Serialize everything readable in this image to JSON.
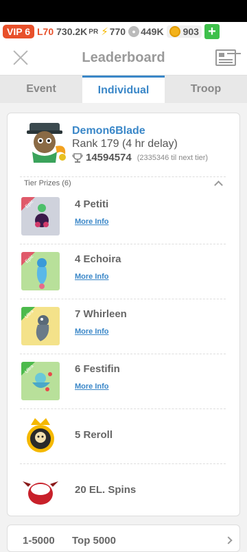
{
  "resources": {
    "vip": "VIP 6",
    "level": "L70",
    "power": "730.2K",
    "power_unit": "PR",
    "energy": "770",
    "food": "449K",
    "gems": "903"
  },
  "header": {
    "title": "Leaderboard"
  },
  "tabs": [
    {
      "label": "Event"
    },
    {
      "label": "Individual",
      "active": true
    },
    {
      "label": "Troop"
    }
  ],
  "player": {
    "name": "Demon6Blade",
    "rank": "Rank 179 (4 hr delay)",
    "score": "14594574",
    "next_tier": "(2335346 til next tier)"
  },
  "tier_prizes": {
    "label": "Tier Prizes (6)",
    "items": [
      {
        "name": "4 Petiti",
        "more": "More Info",
        "badge": "Epic",
        "bg": "#cfd2dc"
      },
      {
        "name": "4 Echoira",
        "more": "More Info",
        "badge": "Epic",
        "bg": "#b8e09a"
      },
      {
        "name": "7 Whirleen",
        "more": "More Info",
        "badge": "Ultra",
        "bg": "#f4e28a"
      },
      {
        "name": "6 Festifin",
        "more": "More Info",
        "badge": "Ultra",
        "bg": "#b8e09a"
      },
      {
        "name": "5 Reroll"
      },
      {
        "name": "20 EL. Spins"
      }
    ]
  },
  "footer": {
    "range": "1-5000",
    "label": "Top 5000"
  }
}
